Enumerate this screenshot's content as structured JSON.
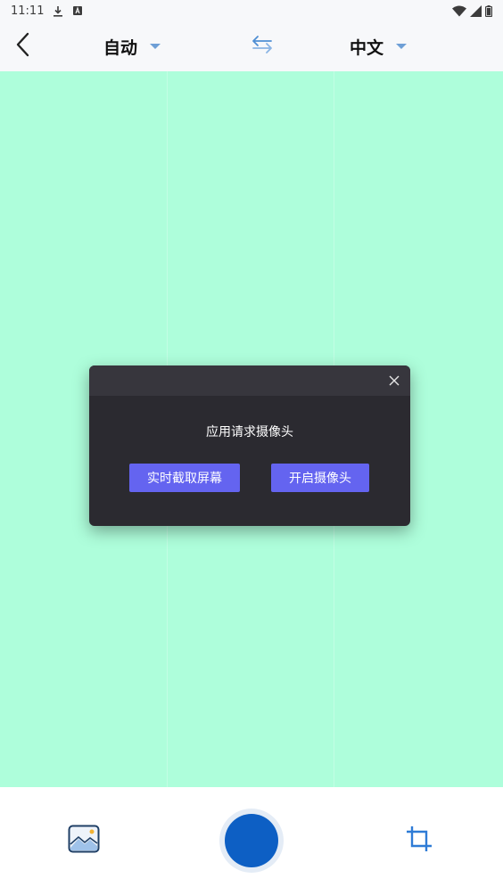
{
  "status_bar": {
    "time": "11:11",
    "icons_left": [
      "download-icon",
      "a-icon"
    ],
    "icons_right": [
      "wifi-icon",
      "signal-icon",
      "battery-icon"
    ]
  },
  "toolbar": {
    "back_icon": "chevron-left-icon",
    "source_language": "自动",
    "swap_icon": "swap-icon",
    "target_language": "中文",
    "caret_color": "#6e9fd6"
  },
  "camera_area": {
    "background_color": "#aefedb"
  },
  "dialog": {
    "message": "应用请求摄像头",
    "close_icon": "close-icon",
    "screen_capture_button": "实时截取屏幕",
    "open_camera_button": "开启摄像头",
    "button_color": "#6464f0",
    "background_color": "#2b2a30"
  },
  "bottom_bar": {
    "gallery_icon": "image-icon",
    "shutter_color": "#0d5fc4",
    "crop_icon": "crop-icon"
  }
}
